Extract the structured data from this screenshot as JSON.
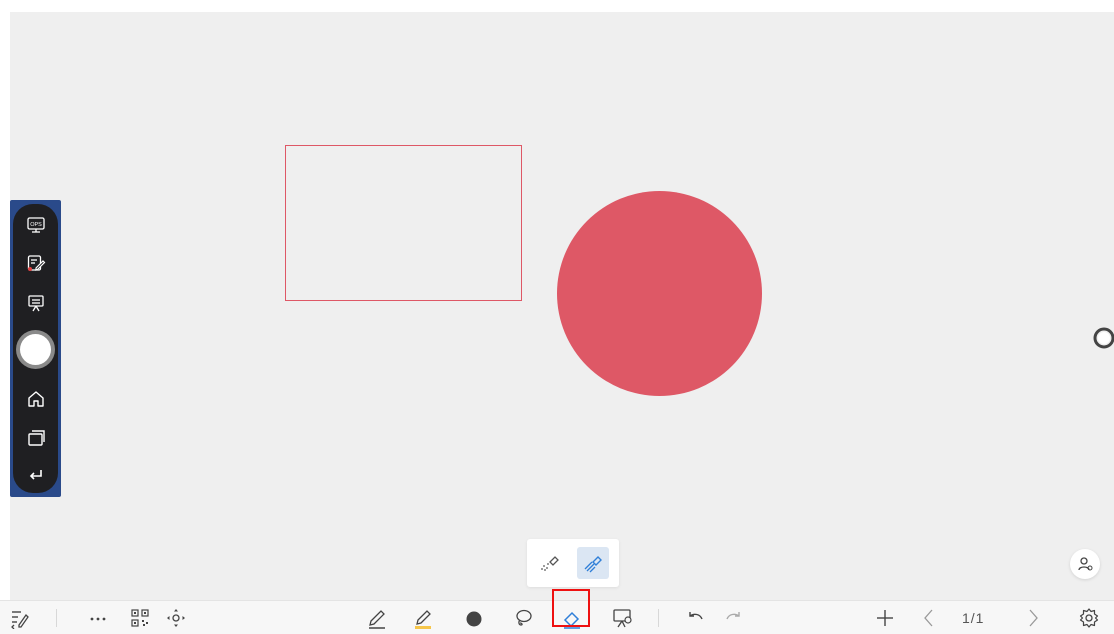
{
  "canvas": {
    "background": "#efefef",
    "shape_color": "#de5866"
  },
  "side_panel": {
    "items": [
      {
        "name": "ops-icon",
        "label": "OPS"
      },
      {
        "name": "note-edit-icon"
      },
      {
        "name": "presentation-icon"
      },
      {
        "name": "home-icon"
      },
      {
        "name": "windows-icon"
      },
      {
        "name": "back-icon"
      }
    ]
  },
  "eraser_popup": {
    "options": [
      {
        "name": "eraser-small-icon",
        "active": false
      },
      {
        "name": "eraser-large-icon",
        "active": true
      }
    ]
  },
  "toolbar": {
    "page_indicator": "1/1",
    "left_tools": [
      "exit-annotation-icon",
      "more-icon",
      "qr-code-icon",
      "move-icon"
    ],
    "center_tools": [
      "pen-icon",
      "highlighter-icon",
      "shape-icon",
      "lasso-icon",
      "eraser-icon",
      "whiteboard-icon"
    ],
    "history_tools": [
      "undo-icon",
      "redo-icon"
    ],
    "page_tools": [
      "add-page-icon",
      "prev-page-icon",
      "next-page-icon",
      "settings-icon"
    ],
    "highlighted_tool": "eraser-icon",
    "highlight_color": "#ee1111"
  }
}
